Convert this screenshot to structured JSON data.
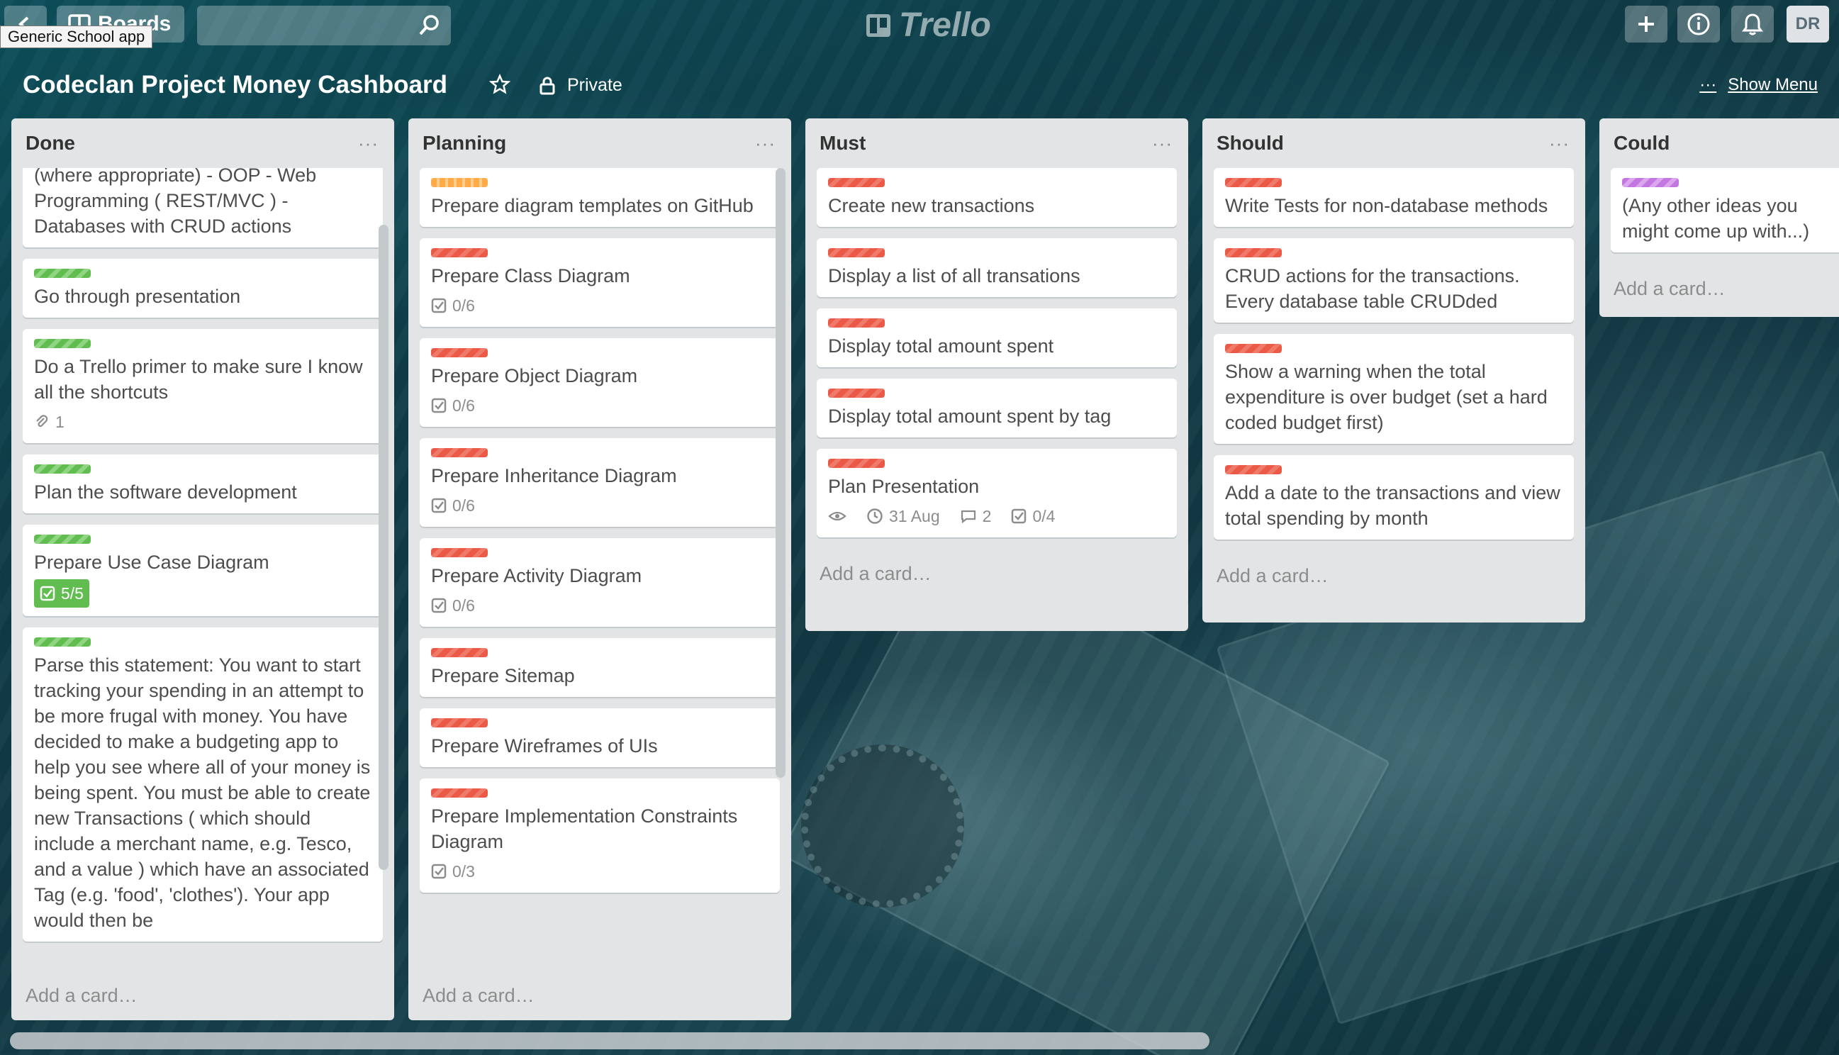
{
  "header": {
    "boards_label": "Boards",
    "tooltip": "Generic School app",
    "logo_text": "Trello",
    "avatar_initials": "DR"
  },
  "board": {
    "title": "Codeclan Project Money Cashboard",
    "visibility": "Private",
    "show_menu": "Show Menu"
  },
  "add_card_label": "Add a card…",
  "lists": [
    {
      "title": "Done",
      "cards": [
        {
          "text": "(where appropriate) - OOP - Web Programming ( REST/MVC ) - Databases with CRUD actions",
          "labels": []
        },
        {
          "text": "Go through presentation",
          "labels": [
            "green"
          ]
        },
        {
          "text": "Do a Trello primer to make sure I know all the shortcuts",
          "labels": [
            "green"
          ],
          "attachments": "1"
        },
        {
          "text": "Plan the software development",
          "labels": [
            "green"
          ]
        },
        {
          "text": "Prepare Use Case Diagram",
          "labels": [
            "green"
          ],
          "checklist": "5/5"
        },
        {
          "text": "Parse this statement: You want to start tracking your spending in an attempt to be more frugal with money. You have decided to make a budgeting app to help you see where all of your money is being spent. You must be able to create new Transactions ( which should include a merchant name, e.g. Tesco, and a value ) which have an associated Tag (e.g. 'food', 'clothes'). Your app would then be",
          "labels": [
            "green"
          ]
        }
      ]
    },
    {
      "title": "Planning",
      "cards": [
        {
          "text": "Prepare diagram templates on GitHub",
          "labels": [
            "orange"
          ]
        },
        {
          "text": "Prepare Class Diagram",
          "labels": [
            "red"
          ],
          "checklist": "0/6"
        },
        {
          "text": "Prepare Object Diagram",
          "labels": [
            "red"
          ],
          "checklist": "0/6"
        },
        {
          "text": "Prepare Inheritance Diagram",
          "labels": [
            "red"
          ],
          "checklist": "0/6"
        },
        {
          "text": "Prepare Activity Diagram",
          "labels": [
            "red"
          ],
          "checklist": "0/6"
        },
        {
          "text": "Prepare Sitemap",
          "labels": [
            "red"
          ]
        },
        {
          "text": "Prepare Wireframes of UIs",
          "labels": [
            "red"
          ]
        },
        {
          "text": "Prepare Implementation Constraints Diagram",
          "labels": [
            "red"
          ],
          "checklist": "0/3"
        }
      ]
    },
    {
      "title": "Must",
      "cards": [
        {
          "text": "Create new transactions",
          "labels": [
            "red"
          ]
        },
        {
          "text": "Display a list of all transations",
          "labels": [
            "red"
          ]
        },
        {
          "text": "Display total amount spent",
          "labels": [
            "red"
          ]
        },
        {
          "text": "Display total amount spent by tag",
          "labels": [
            "red"
          ]
        },
        {
          "text": "Plan Presentation",
          "labels": [
            "red"
          ],
          "due": "31 Aug",
          "comments": "2",
          "checklist": "0/4",
          "watching": true
        }
      ]
    },
    {
      "title": "Should",
      "cards": [
        {
          "text": "Write Tests for non-database methods",
          "labels": [
            "red"
          ]
        },
        {
          "text": "CRUD actions for the transactions. Every database table CRUDded",
          "labels": [
            "red"
          ]
        },
        {
          "text": "Show a warning when the total expenditure is over budget (set a hard coded budget first)",
          "labels": [
            "red"
          ]
        },
        {
          "text": "Add a date to the transactions and view total spending by month",
          "labels": [
            "red"
          ]
        }
      ]
    },
    {
      "title": "Could",
      "cards": [
        {
          "text": "(Any other ideas you might come up with...)",
          "labels": [
            "purple"
          ]
        }
      ]
    }
  ]
}
